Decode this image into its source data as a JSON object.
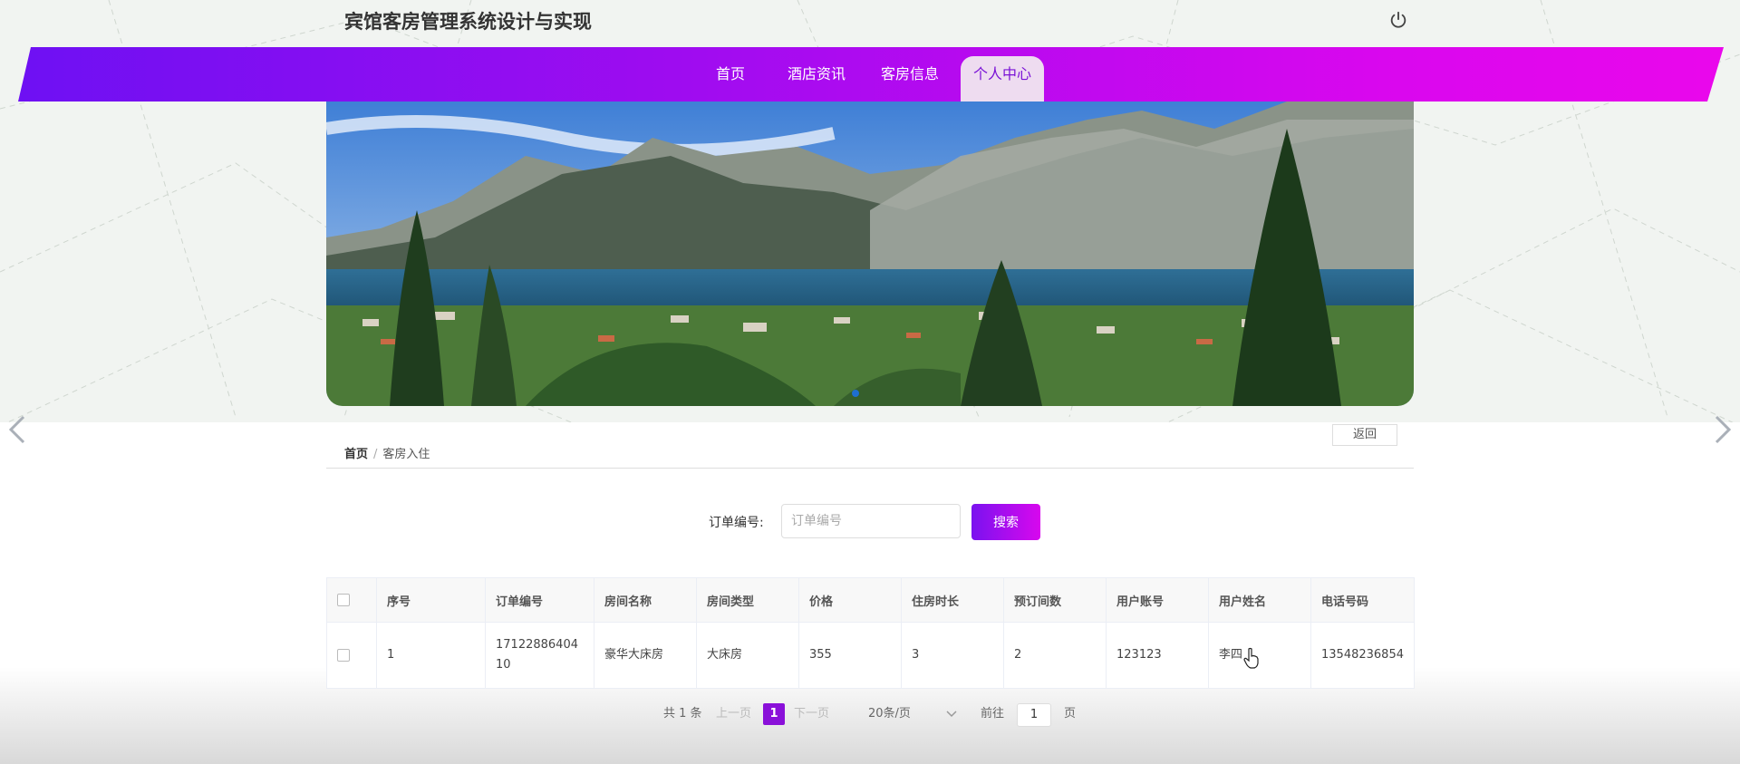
{
  "header": {
    "title": "宾馆客房管理系统设计与实现",
    "power_icon": "power-icon"
  },
  "nav": {
    "items": [
      {
        "label": "首页",
        "active": false
      },
      {
        "label": "酒店资讯",
        "active": false
      },
      {
        "label": "客房信息",
        "active": false
      },
      {
        "label": "个人中心",
        "active": true
      }
    ],
    "colors": {
      "gradient_start": "#6e10f3",
      "gradient_end": "#ea07ec",
      "active_bg": "#eedcf0"
    }
  },
  "banner": {
    "image": "lake-and-mountains-photo",
    "carousel_dots": 1
  },
  "breadcrumb": {
    "home": "首页",
    "separator": "/",
    "current": "客房入住"
  },
  "back_button": "返回",
  "search": {
    "label": "订单编号:",
    "placeholder": "订单编号",
    "value": "",
    "button": "搜索"
  },
  "table": {
    "columns": [
      "序号",
      "订单编号",
      "房间名称",
      "房间类型",
      "价格",
      "住房时长",
      "预订间数",
      "用户账号",
      "用户姓名",
      "电话号码"
    ],
    "rows": [
      {
        "index": "1",
        "order_no": "1712288640410",
        "room_name": "豪华大床房",
        "room_type": "大床房",
        "price": "355",
        "duration": "3",
        "rooms": "2",
        "account": "123123",
        "user_name": "李四",
        "phone": "13548236854"
      }
    ]
  },
  "pagination": {
    "total": "共 1 条",
    "prev": "上一页",
    "current_page": "1",
    "next": "下一页",
    "page_size": "20条/页",
    "goto_label": "前往",
    "goto_value": "1",
    "goto_suffix": "页"
  }
}
